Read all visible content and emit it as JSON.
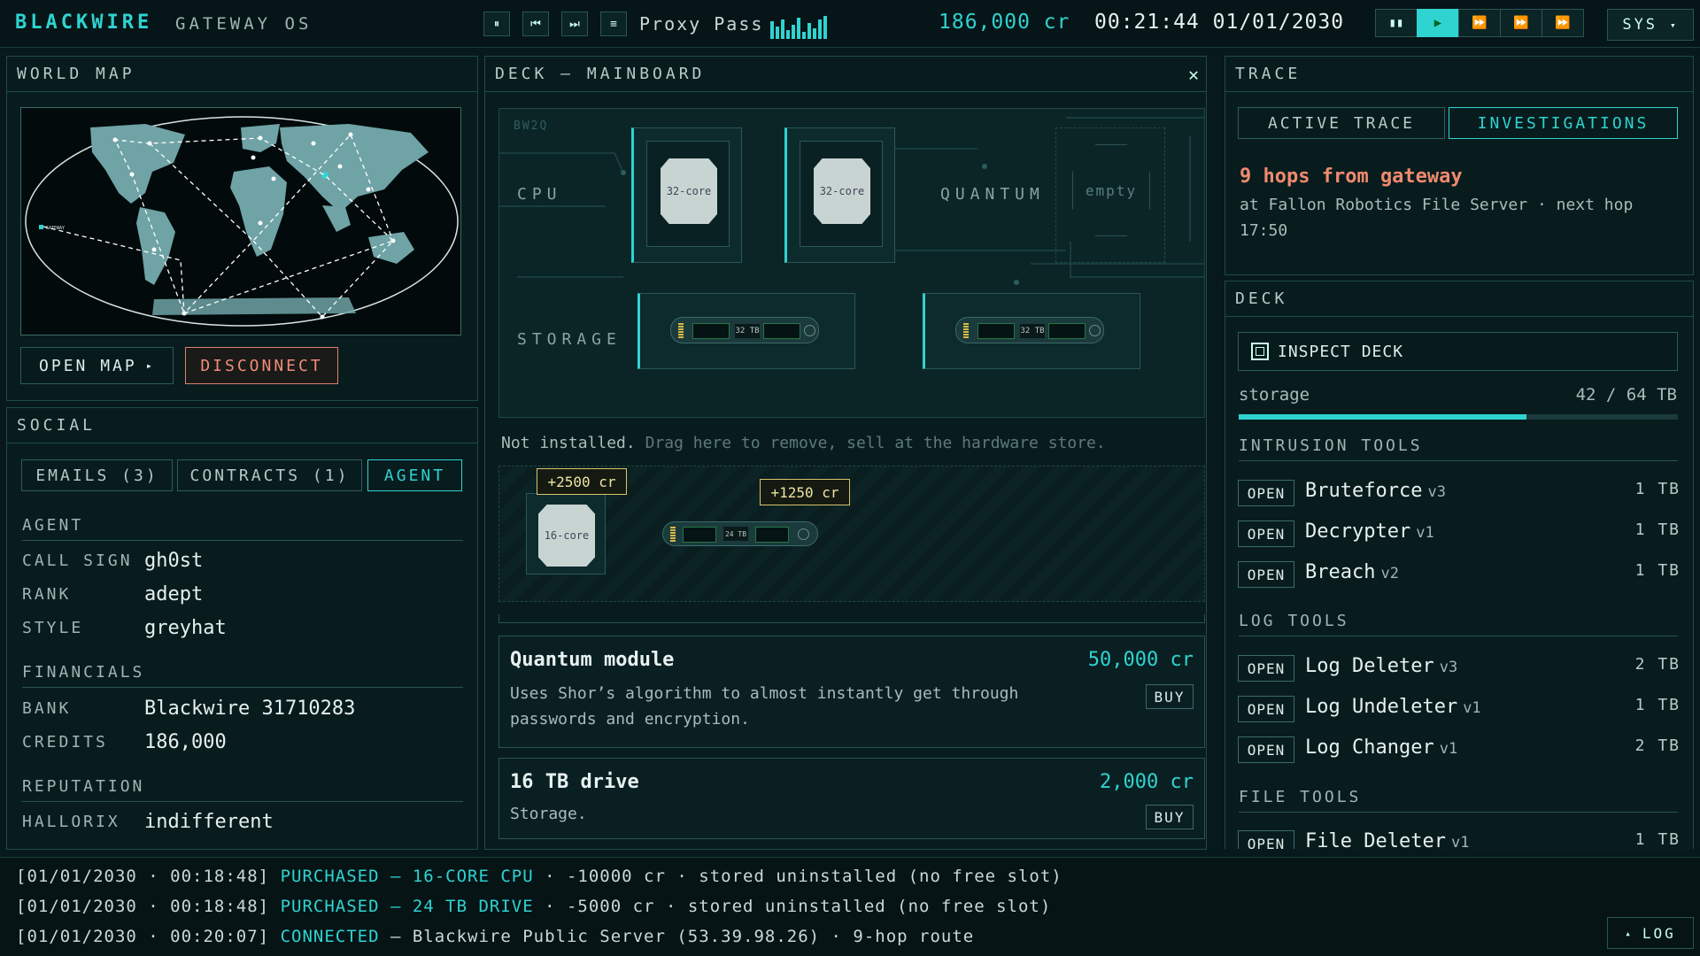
{
  "topbar": {
    "brand": "BLACKWIRE",
    "brand_sub": "GATEWAY OS",
    "track": "Proxy Pass",
    "credits": "186,000 cr",
    "clock": "00:21:44 01/01/2030",
    "sys_label": "SYS",
    "icons": {
      "pause": "⏸",
      "prev": "⏮",
      "next": "⏭",
      "playlist": "≡",
      "speed_pause": "▮▮",
      "speed_play": "▶",
      "speed_2": "⏩",
      "speed_3": "⏩",
      "speed_4": "⏩"
    }
  },
  "worldmap": {
    "title": "WORLD MAP",
    "gateway_label": "GATEWAY",
    "open_map": "OPEN MAP",
    "open_map_arrow": "▸",
    "disconnect": "DISCONNECT"
  },
  "social": {
    "title": "SOCIAL",
    "tabs": [
      "EMAILS (3)",
      "CONTRACTS (1)",
      "AGENT"
    ],
    "active_tab": "AGENT",
    "agent_label": "AGENT",
    "call_sign_k": "CALL SIGN",
    "call_sign_v": "gh0st",
    "rank_k": "RANK",
    "rank_v": "adept",
    "style_k": "STYLE",
    "style_v": "greyhat",
    "financials_label": "FINANCIALS",
    "bank_k": "BANK",
    "bank_v": "Blackwire 31710283",
    "credits_k": "CREDITS",
    "credits_v": "186,000",
    "reputation_label": "REPUTATION",
    "hallorix_k": "HALLORIX",
    "hallorix_v": "indifferent"
  },
  "deck_main": {
    "title": "DECK — MAINBOARD",
    "close": "✕",
    "board_id": "BW2Q",
    "cpu_label": "CPU",
    "quantum_label": "QUANTUM",
    "storage_label": "STORAGE",
    "cpu_slots": [
      "32-core",
      "32-core"
    ],
    "quantum_slot": "empty",
    "storage_slots": [
      "32 TB",
      "32 TB"
    ],
    "not_installed": "Not installed.",
    "not_installed_hint": "Drag here to remove, sell at the hardware store.",
    "inventory": [
      {
        "label": "16-core",
        "price": "+2500 cr"
      },
      {
        "label": "24 TB",
        "price": "+1250 cr"
      }
    ],
    "shop": [
      {
        "title": "Quantum module",
        "price": "50,000 cr",
        "desc_1": "Uses Shor’s algorithm to almost instantly get through",
        "desc_2": "passwords and encryption.",
        "buy": "BUY"
      },
      {
        "title": "16 TB drive",
        "price": "2,000 cr",
        "desc_1": "Storage.",
        "buy": "BUY"
      }
    ]
  },
  "trace": {
    "title": "TRACE",
    "tabs": [
      "ACTIVE TRACE",
      "INVESTIGATIONS"
    ],
    "active_tab": "INVESTIGATIONS",
    "headline": "9 hops from gateway",
    "detail_1": "at Fallon Robotics File Server · next hop",
    "detail_2": "17:50"
  },
  "deck_right": {
    "title": "DECK",
    "inspect": "INSPECT DECK",
    "storage_label": "storage",
    "storage_value": "42 / 64 TB",
    "storage_fraction": 0.656,
    "intrusion_label": "INTRUSION TOOLS",
    "intrusion": [
      {
        "open": "OPEN",
        "name": "Bruteforce",
        "ver": "v3",
        "size": "1 TB"
      },
      {
        "open": "OPEN",
        "name": "Decrypter",
        "ver": "v1",
        "size": "1 TB"
      },
      {
        "open": "OPEN",
        "name": "Breach",
        "ver": "v2",
        "size": "1 TB"
      }
    ],
    "log_label": "LOG TOOLS",
    "log": [
      {
        "open": "OPEN",
        "name": "Log Deleter",
        "ver": "v3",
        "size": "2 TB"
      },
      {
        "open": "OPEN",
        "name": "Log Undeleter",
        "ver": "v1",
        "size": "1 TB"
      },
      {
        "open": "OPEN",
        "name": "Log Changer",
        "ver": "v1",
        "size": "2 TB"
      }
    ],
    "file_label": "FILE TOOLS",
    "file": [
      {
        "open": "OPEN",
        "name": "File Deleter",
        "ver": "v1",
        "size": "1 TB"
      }
    ]
  },
  "log": {
    "lines": [
      {
        "ts": "[01/01/2030 · 00:18:48]",
        "action": "PURCHASED — 16-CORE CPU",
        "rest": " · -10000 cr · stored uninstalled (no free slot)"
      },
      {
        "ts": "[01/01/2030 · 00:18:48]",
        "action": "PURCHASED — 24 TB DRIVE",
        "rest": " · -5000 cr · stored uninstalled (no free slot)"
      },
      {
        "ts": "[01/01/2030 · 00:20:07]",
        "action": "CONNECTED",
        "rest": " — Blackwire Public Server (53.39.98.26) · 9-hop route"
      }
    ],
    "button": "LOG",
    "button_arrow": "▴"
  },
  "colors": {
    "accent": "#2fd3d0",
    "danger": "#ef8d79",
    "trace": "#f08a6e",
    "price_tag": "#d9c46a",
    "background": "#07191b"
  }
}
